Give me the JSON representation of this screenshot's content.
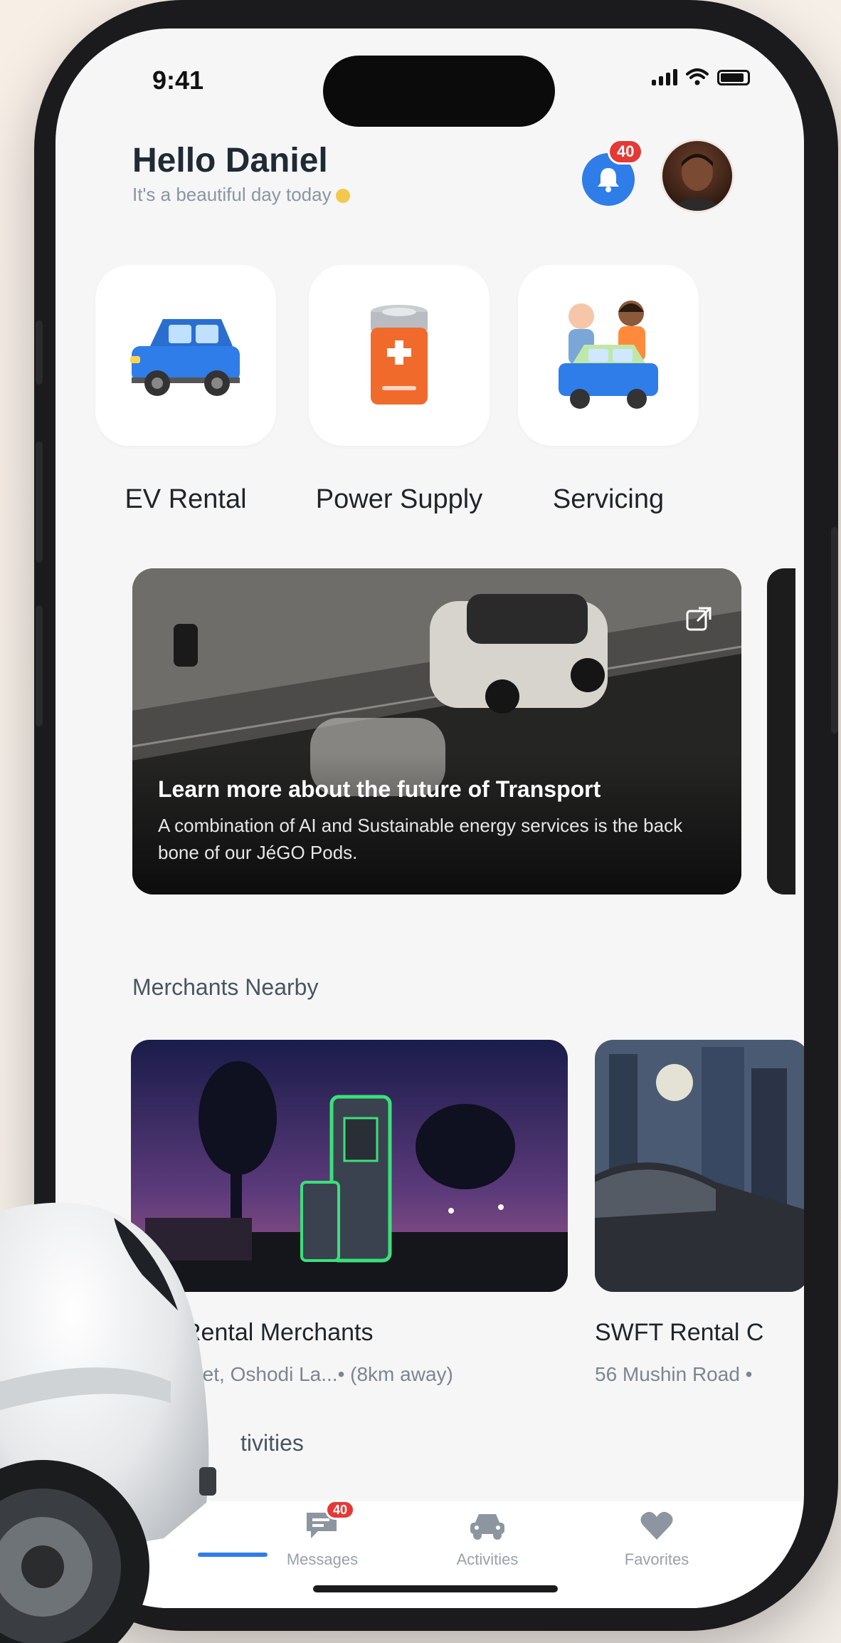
{
  "status_bar": {
    "time": "9:41"
  },
  "header": {
    "greeting": "Hello Daniel",
    "subtitle": "It's a beautiful day today",
    "notification_count": "40"
  },
  "services": [
    {
      "label": "EV Rental",
      "icon": "car-icon"
    },
    {
      "label": "Power Supply",
      "icon": "battery-icon"
    },
    {
      "label": "Servicing",
      "icon": "people-car-icon"
    }
  ],
  "banner": {
    "title": "Learn more about the future of Transport",
    "description": "A combination of AI and Sustainable energy services is the back bone of our JéGO Pods."
  },
  "merchants": {
    "section_title": "Merchants Nearby",
    "items": [
      {
        "name": "Rental Merchants",
        "address": "treet, Oshodi La...• (8km away)"
      },
      {
        "name": "SWFT Rental C",
        "address": "56 Mushin Road •"
      }
    ]
  },
  "activities": {
    "section_title": "tivities"
  },
  "tabbar": {
    "items": [
      {
        "label": "Messages",
        "badge": "40",
        "icon": "message-icon"
      },
      {
        "label": "Activities",
        "icon": "car-front-icon"
      },
      {
        "label": "Favorites",
        "icon": "heart-icon"
      }
    ]
  },
  "colors": {
    "accent": "#2f7de8",
    "badge": "#e53935",
    "tile_car": "#2f7de8",
    "tile_battery": "#f06a2c"
  }
}
